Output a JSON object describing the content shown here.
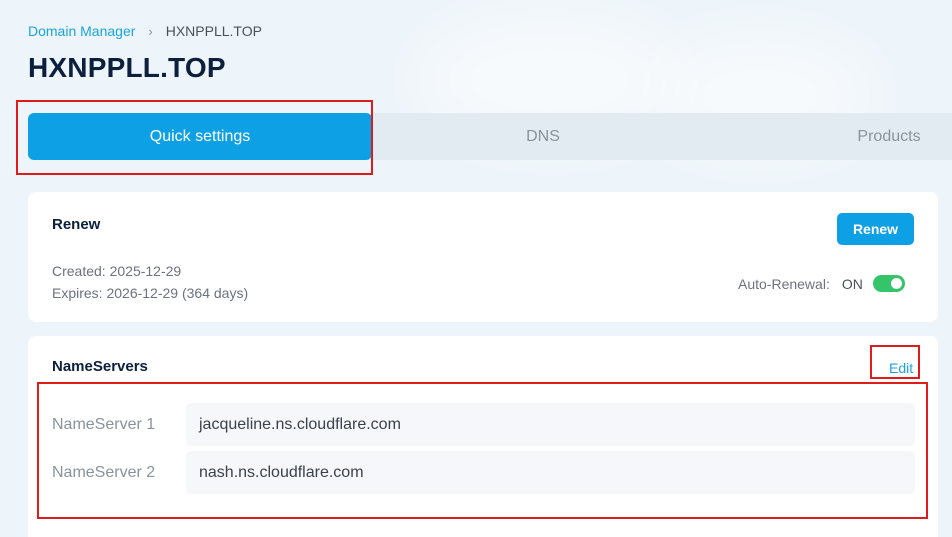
{
  "breadcrumb": {
    "parent": "Domain Manager",
    "separator": "›",
    "current": "HXNPPLL.TOP"
  },
  "page": {
    "title": "HXNPPLL.TOP"
  },
  "tabs": [
    {
      "label": "Quick settings",
      "active": true
    },
    {
      "label": "DNS",
      "active": false
    },
    {
      "label": "Products",
      "active": false
    }
  ],
  "renew": {
    "title": "Renew",
    "button_label": "Renew",
    "created": "Created: 2025-12-29",
    "expires": "Expires: 2026-12-29 (364 days)",
    "auto_renewal_label": "Auto-Renewal:",
    "auto_renewal_state": "ON"
  },
  "nameservers": {
    "title": "NameServers",
    "edit_label": "Edit",
    "items": [
      {
        "label": "NameServer 1",
        "value": "jacqueline.ns.cloudflare.com"
      },
      {
        "label": "NameServer 2",
        "value": "nash.ns.cloudflare.com"
      }
    ]
  },
  "colors": {
    "accent": "#0ea0e4",
    "toggle_on": "#34c46a",
    "annotation": "#e01b1b",
    "title": "#0c1f3d"
  }
}
